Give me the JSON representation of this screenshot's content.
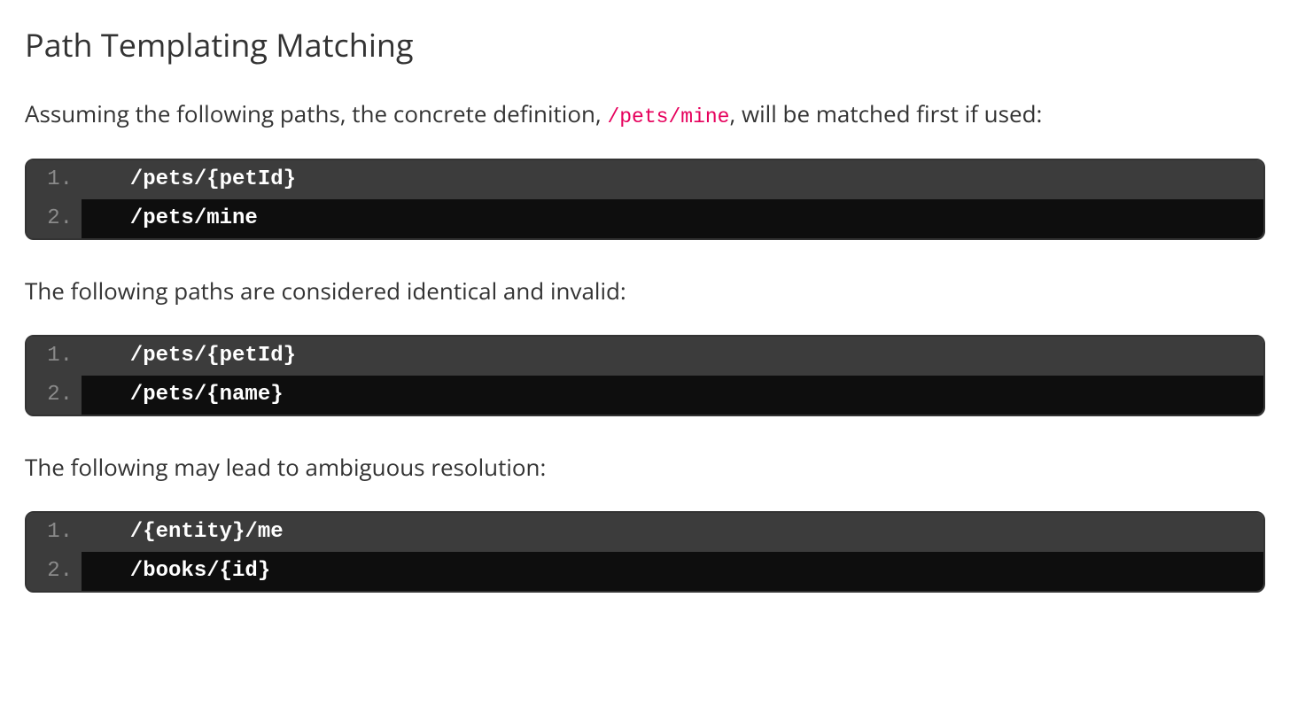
{
  "heading": "Path Templating Matching",
  "para1_before": "Assuming the following paths, the concrete definition, ",
  "para1_code": "/pets/mine",
  "para1_after": ", will be matched first if used:",
  "block1": {
    "lines": [
      {
        "n": "1.",
        "code": "  /pets/{petId}"
      },
      {
        "n": "2.",
        "code": "  /pets/mine"
      }
    ]
  },
  "para2": "The following paths are considered identical and invalid:",
  "block2": {
    "lines": [
      {
        "n": "1.",
        "code": "  /pets/{petId}"
      },
      {
        "n": "2.",
        "code": "  /pets/{name}"
      }
    ]
  },
  "para3": "The following may lead to ambiguous resolution:",
  "block3": {
    "lines": [
      {
        "n": "1.",
        "code": "  /{entity}/me"
      },
      {
        "n": "2.",
        "code": "  /books/{id}"
      }
    ]
  }
}
